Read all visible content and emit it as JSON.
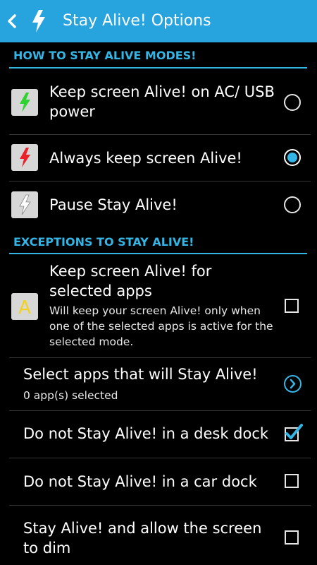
{
  "actionbar": {
    "title": "Stay Alive! Options",
    "back_icon": "back-chevron-icon",
    "app_icon": "lightning-bolt-icon"
  },
  "sections": {
    "modes_header": "HOW TO STAY ALIVE MODES!",
    "exceptions_header": "EXCEPTIONS TO STAY ALIVE!"
  },
  "modes": [
    {
      "label": "Keep screen Alive! on AC/ USB power",
      "icon": "green-bolt-icon",
      "selected": false
    },
    {
      "label": "Always keep screen Alive!",
      "icon": "red-bolt-icon",
      "selected": true
    },
    {
      "label": "Pause Stay Alive!",
      "icon": "white-bolt-icon",
      "selected": false
    }
  ],
  "exceptions": {
    "selected_apps": {
      "title": "Keep screen Alive! for selected apps",
      "summary": "Will keep your screen Alive! only when one of the selected apps is active for the selected mode.",
      "icon_letter": "A",
      "checked": false
    },
    "select_apps": {
      "title": "Select apps that will Stay Alive!",
      "summary": "0 app(s) selected"
    },
    "desk_dock": {
      "title": "Do not Stay Alive! in a desk dock",
      "checked": true
    },
    "car_dock": {
      "title": "Do not Stay Alive! in a car dock",
      "checked": false
    },
    "allow_dim": {
      "title": "Stay Alive! and allow the screen to dim",
      "checked": false
    }
  },
  "colors": {
    "actionbar": "#27a3dd",
    "accent": "#33b5e5",
    "background": "#000000",
    "icon_bg": "#d7d7d7",
    "bolt_green": "#2fd22f",
    "bolt_red": "#e8232a",
    "letter_yellow": "#f2d21a"
  }
}
